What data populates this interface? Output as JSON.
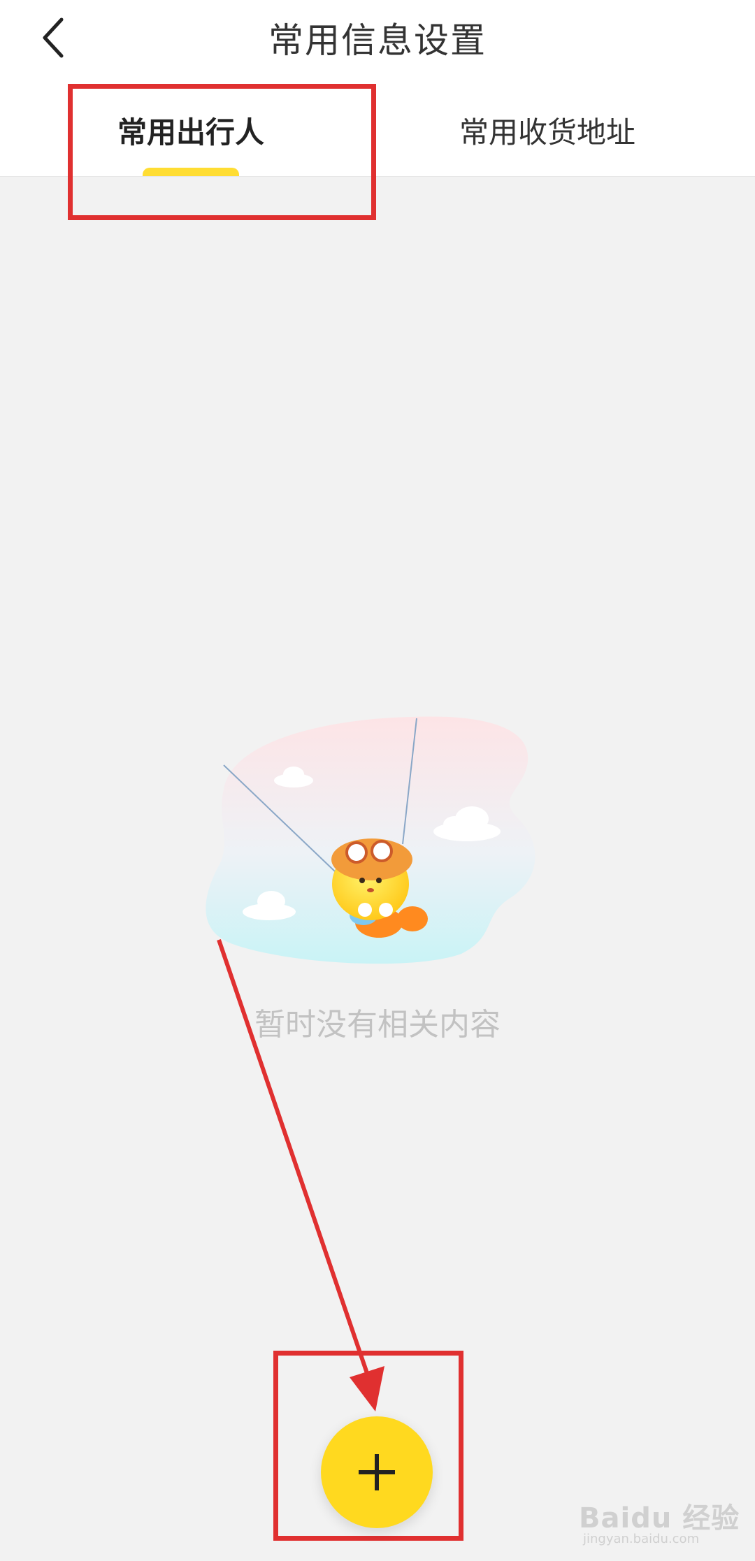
{
  "header": {
    "title": "常用信息设置",
    "back_icon": "chevron-left-icon"
  },
  "tabs": [
    {
      "label": "常用出行人",
      "active": true
    },
    {
      "label": "常用收货地址",
      "active": false
    }
  ],
  "colors": {
    "accent": "#ffd91f",
    "annotation": "#e03030",
    "background": "#f2f2f2"
  },
  "empty_state": {
    "message": "暂时没有相关内容",
    "illustration": "parachute-mascot-illustration"
  },
  "add_button": {
    "icon": "plus-icon"
  },
  "watermark": {
    "main": "Baidu 经验",
    "sub": "jingyan.baidu.com"
  }
}
